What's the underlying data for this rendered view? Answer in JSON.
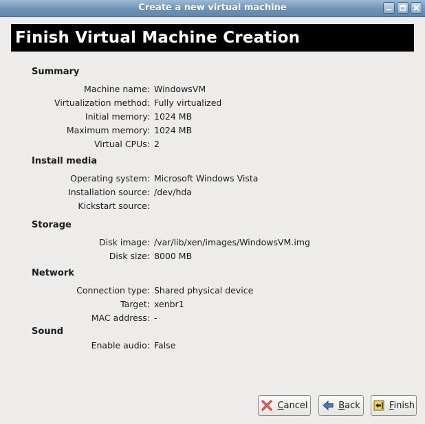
{
  "window": {
    "title": "Create a new virtual machine"
  },
  "banner": {
    "title": "Finish Virtual Machine Creation"
  },
  "sections": {
    "summary": {
      "title": "Summary",
      "rows": [
        {
          "label": "Machine name:",
          "value": "WindowsVM"
        },
        {
          "label": "Virtualization method:",
          "value": "Fully virtualized"
        },
        {
          "label": "Initial memory:",
          "value": "1024 MB"
        },
        {
          "label": "Maximum memory:",
          "value": "1024 MB"
        },
        {
          "label": "Virtual CPUs:",
          "value": "2"
        }
      ]
    },
    "install_media": {
      "title": "Install media",
      "rows": [
        {
          "label": "Operating system:",
          "value": "Microsoft Windows Vista"
        },
        {
          "label": "Installation source:",
          "value": "/dev/hda"
        },
        {
          "label": "Kickstart source:",
          "value": ""
        }
      ]
    },
    "storage": {
      "title": "Storage",
      "rows": [
        {
          "label": "Disk image:",
          "value": "/var/lib/xen/images/WindowsVM.img"
        },
        {
          "label": "Disk size:",
          "value": "8000 MB"
        }
      ]
    },
    "network": {
      "title": "Network",
      "rows": [
        {
          "label": "Connection type:",
          "value": "Shared physical device"
        },
        {
          "label": "Target:",
          "value": "xenbr1"
        },
        {
          "label": "MAC address:",
          "value": "-"
        }
      ]
    },
    "sound": {
      "title": "Sound",
      "rows": [
        {
          "label": "Enable audio:",
          "value": "False"
        }
      ]
    }
  },
  "buttons": {
    "cancel": {
      "label_rest": "ancel",
      "mnemonic": "C",
      "icon": "cancel-x-icon"
    },
    "back": {
      "label_rest": "ack",
      "mnemonic": "B",
      "icon": "back-arrow-icon"
    },
    "finish": {
      "label_rest": "inish",
      "mnemonic": "F",
      "icon": "finish-icon"
    }
  },
  "colors": {
    "titlebar": "#6f93b8",
    "banner_bg": "#000000",
    "window_bg": "#edeceb",
    "cancel_red": "#d0322a"
  }
}
